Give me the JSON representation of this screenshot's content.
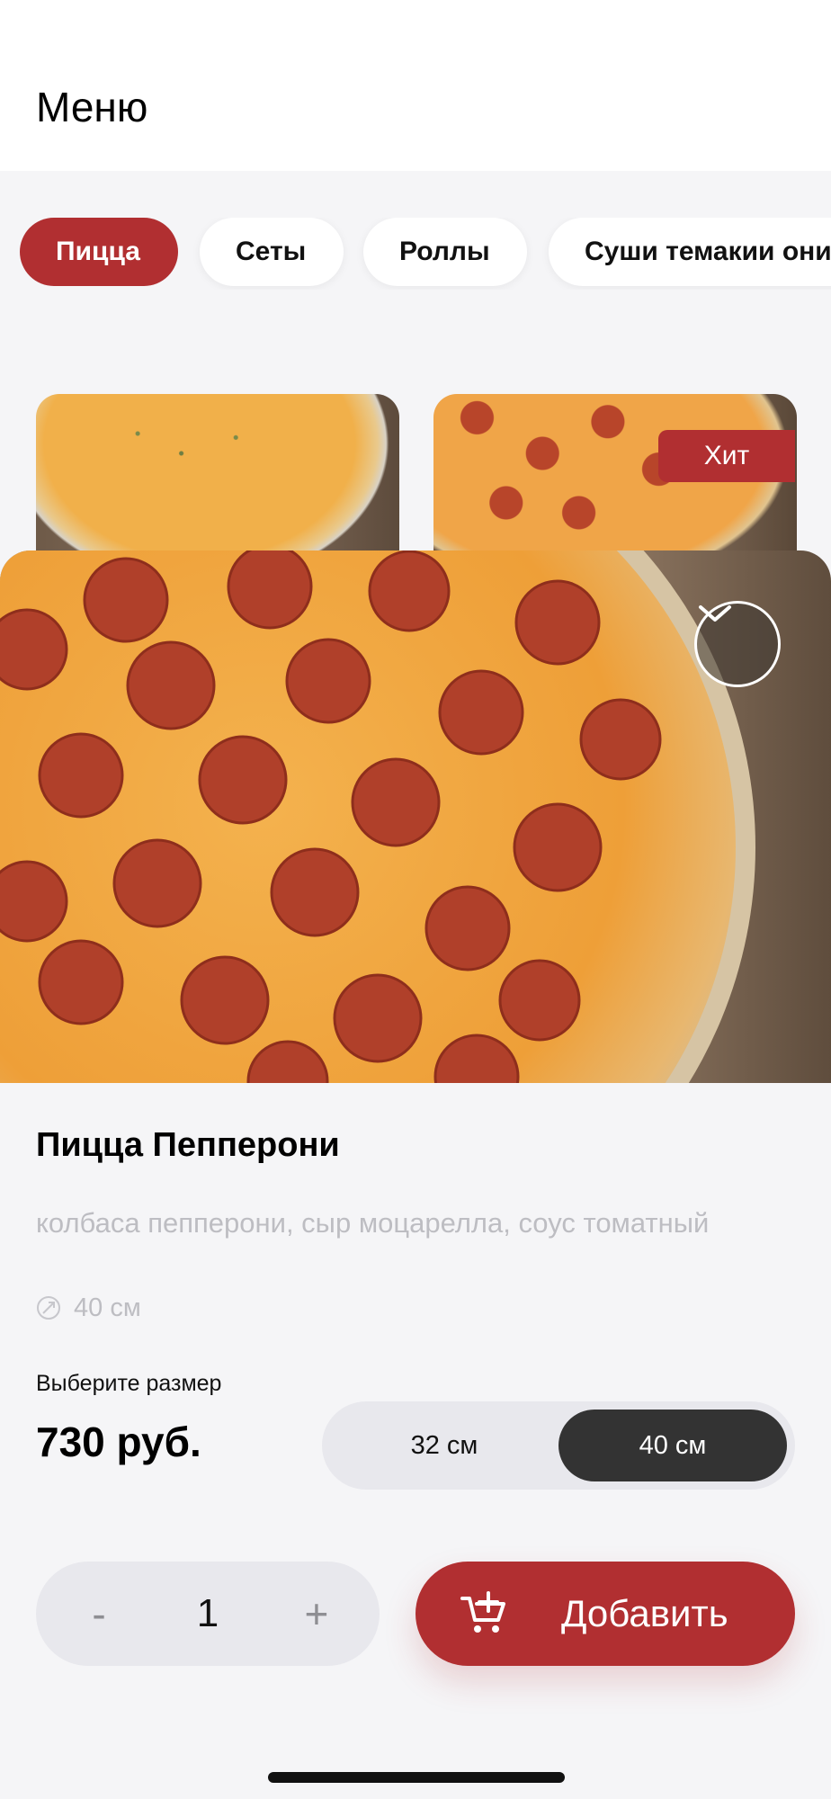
{
  "header": {
    "title": "Меню"
  },
  "categories": [
    {
      "label": "Пицца",
      "active": true
    },
    {
      "label": "Сеты",
      "active": false
    },
    {
      "label": "Роллы",
      "active": false
    },
    {
      "label": "Суши темакии они",
      "active": false
    }
  ],
  "cards": {
    "hit_badge": "Хит"
  },
  "product": {
    "title": "Пицца Пепперони",
    "description": "колбаса пепперони, сыр моцарелла, соус томатный",
    "size_text": "40 см",
    "choose_size_label": "Выберите размер",
    "price": "730 руб.",
    "size_options": [
      {
        "label": "32 см",
        "selected": false
      },
      {
        "label": "40 см",
        "selected": true
      }
    ]
  },
  "quantity": {
    "minus": "-",
    "value": "1",
    "plus": "+"
  },
  "add_button": {
    "label": "Добавить"
  },
  "icons": {
    "collapse": "chevron-down-icon",
    "size": "ruler-icon",
    "cart": "cart-plus-icon"
  },
  "colors": {
    "accent": "#b12f31",
    "dark_toggle": "#333333",
    "muted_text": "#bdbdc2",
    "background": "#f5f5f7"
  }
}
